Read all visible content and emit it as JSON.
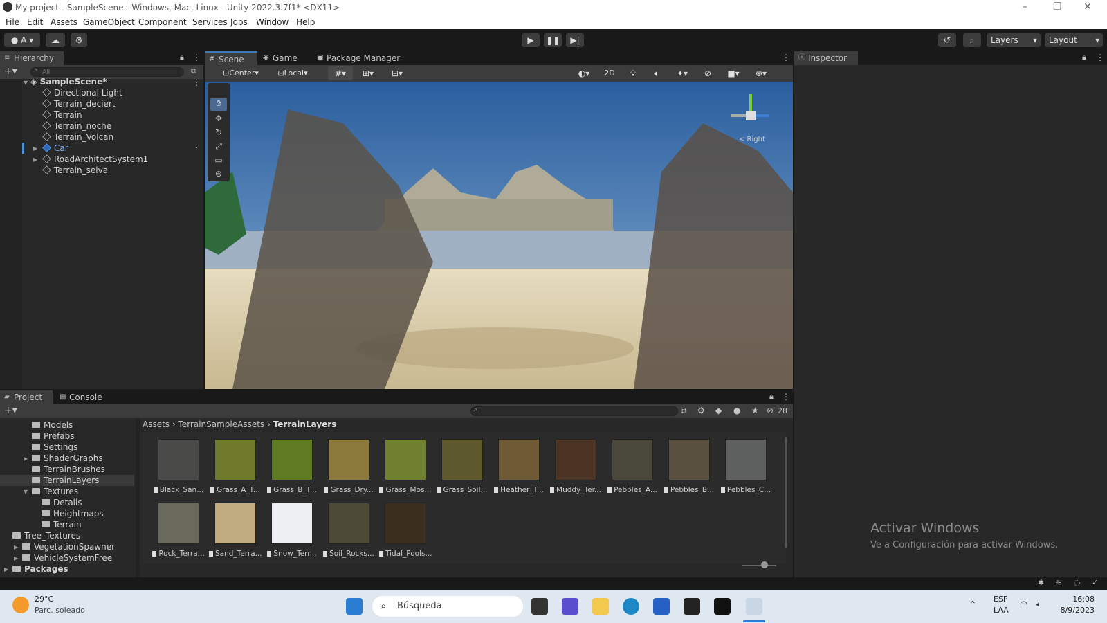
{
  "window": {
    "title": "My project - SampleScene - Windows, Mac, Linux - Unity 2022.3.7f1* <DX11>"
  },
  "menu": [
    "File",
    "Edit",
    "Assets",
    "GameObject",
    "Component",
    "Services",
    "Jobs",
    "Window",
    "Help"
  ],
  "toolbar": {
    "account": "A",
    "layers": "Layers",
    "layout": "Layout"
  },
  "hierarchy": {
    "tab": "Hierarchy",
    "search_placeholder": "All",
    "scene": "SampleScene*",
    "items": [
      "Directional Light",
      "Terrain_deciert",
      "Terrain",
      "Terrain_noche",
      "Terrain_Volcan",
      "Car",
      "RoadArchitectSystem1",
      "Terrain_selva"
    ]
  },
  "scene_tabs": [
    "Scene",
    "Game",
    "Package Manager"
  ],
  "scene_toolbar": {
    "pivot": "Center",
    "space": "Local",
    "mode2d": "2D"
  },
  "gizmo": {
    "label": "< Right"
  },
  "inspector": {
    "tab": "Inspector"
  },
  "bottom_tabs": [
    "Project",
    "Console"
  ],
  "project": {
    "hidden_count": "28",
    "breadcrumb": [
      "Assets",
      "TerrainSampleAssets",
      "TerrainLayers"
    ],
    "tree": [
      "Models",
      "Prefabs",
      "Settings",
      "ShaderGraphs",
      "TerrainBrushes",
      "TerrainLayers",
      "Textures",
      "Details",
      "Heightmaps",
      "Terrain",
      "Tree_Textures",
      "VegetationSpawner",
      "VehicleSystemFree",
      "Packages"
    ],
    "assets": [
      {
        "name": "Black_San...",
        "color": "#4a4a48"
      },
      {
        "name": "Grass_A_T...",
        "color": "#6f7a2c"
      },
      {
        "name": "Grass_B_T...",
        "color": "#5f7a22"
      },
      {
        "name": "Grass_Dry...",
        "color": "#8c7a3c"
      },
      {
        "name": "Grass_Mos...",
        "color": "#6f8030"
      },
      {
        "name": "Grass_Soil...",
        "color": "#5e5a2e"
      },
      {
        "name": "Heather_T...",
        "color": "#6e5a34"
      },
      {
        "name": "Muddy_Ter...",
        "color": "#4b3424"
      },
      {
        "name": "Pebbles_A...",
        "color": "#4a4838"
      },
      {
        "name": "Pebbles_B...",
        "color": "#5a5040"
      },
      {
        "name": "Pebbles_C...",
        "color": "#5e6060"
      },
      {
        "name": "Rock_Terra...",
        "color": "#6a6a5a"
      },
      {
        "name": "Sand_Terra...",
        "color": "#c2ad80"
      },
      {
        "name": "Snow_Terr...",
        "color": "#eef0f4"
      },
      {
        "name": "Soil_Rocks...",
        "color": "#4e4a38"
      },
      {
        "name": "Tidal_Pools...",
        "color": "#3a2e1e"
      }
    ]
  },
  "watermark": {
    "title": "Activar Windows",
    "subtitle": "Ve a Configuración para activar Windows."
  },
  "taskbar": {
    "temp": "29°C",
    "weather": "Parc. soleado",
    "search": "Búsqueda",
    "lang1": "ESP",
    "lang2": "LAA",
    "time": "16:08",
    "date": "8/9/2023"
  }
}
